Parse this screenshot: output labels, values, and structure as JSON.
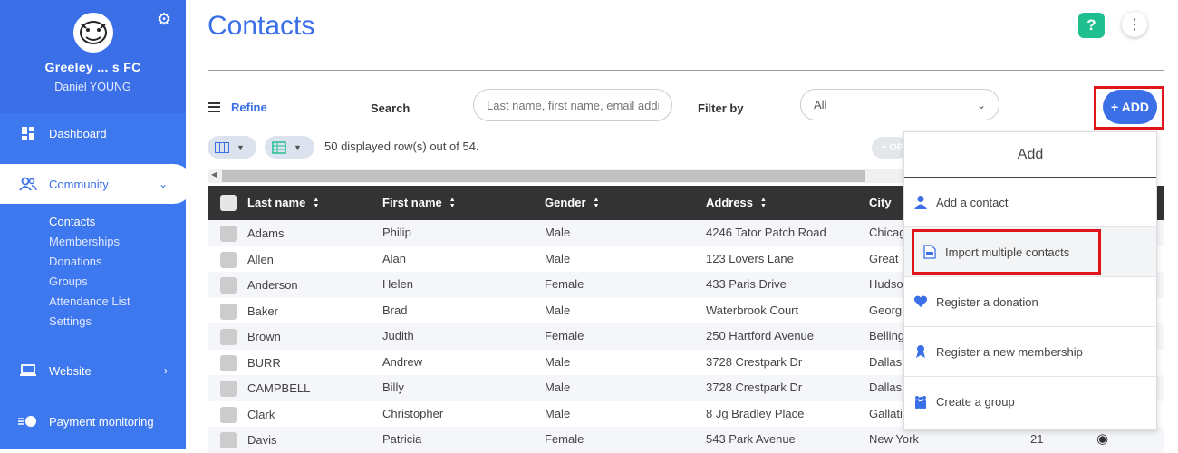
{
  "sidebar": {
    "club_name": "Greeley ... s FC",
    "user_name": "Daniel YOUNG",
    "items": [
      {
        "label": "Dashboard"
      },
      {
        "label": "Community"
      },
      {
        "label": "Website"
      },
      {
        "label": "Payment monitoring"
      }
    ],
    "community_sub": [
      "Contacts",
      "Memberships",
      "Donations",
      "Groups",
      "Attendance List",
      "Settings"
    ]
  },
  "header": {
    "title": "Contacts",
    "help_label": "?"
  },
  "toolbar": {
    "refine_label": "Refine",
    "search_label": "Search",
    "search_placeholder": "Last name, first name, email addr",
    "filter_label": "Filter by",
    "filter_value": "All",
    "add_label": "+ ADD",
    "rows_info": "50 displayed row(s) out of 54.",
    "ghost_label": "+ OP"
  },
  "table": {
    "columns": [
      "Last name",
      "First name",
      "Gender",
      "Address",
      "City"
    ],
    "rows": [
      {
        "last": "Adams",
        "first": "Philip",
        "gender": "Male",
        "address": "4246 Tator Patch Road",
        "city": "Chicag"
      },
      {
        "last": "Allen",
        "first": "Alan",
        "gender": "Male",
        "address": "123 Lovers Lane",
        "city": "Great F"
      },
      {
        "last": "Anderson",
        "first": "Helen",
        "gender": "Female",
        "address": "433 Paris Drive",
        "city": "Hudso"
      },
      {
        "last": "Baker",
        "first": "Brad",
        "gender": "Male",
        "address": "Waterbrook Court",
        "city": "Georgi"
      },
      {
        "last": "Brown",
        "first": "Judith",
        "gender": "Female",
        "address": "250 Hartford Avenue",
        "city": "Belling"
      },
      {
        "last": "BURR",
        "first": "Andrew",
        "gender": "Male",
        "address": "3728 Crestpark Dr",
        "city": "Dallas"
      },
      {
        "last": "CAMPBELL",
        "first": "Billy",
        "gender": "Male",
        "address": "3728 Crestpark Dr",
        "city": "Dallas"
      },
      {
        "last": "Clark",
        "first": "Christopher",
        "gender": "Male",
        "address": "8 Jg Bradley Place",
        "city": "Gallatin"
      },
      {
        "last": "Davis",
        "first": "Patricia",
        "gender": "Female",
        "address": "543 Park Avenue",
        "city": "New York",
        "extra": "21"
      }
    ]
  },
  "add_menu": {
    "title": "Add",
    "items": [
      {
        "label": "Add a contact",
        "icon": "person-icon"
      },
      {
        "label": "Import multiple contacts",
        "icon": "import-file-icon"
      },
      {
        "label": "Register a donation",
        "icon": "heart-icon"
      },
      {
        "label": "Register a new membership",
        "icon": "ribbon-icon"
      },
      {
        "label": "Create a group",
        "icon": "group-icon"
      }
    ]
  },
  "colors": {
    "primary": "#3a6fe8",
    "highlight": "#e0141b",
    "help": "#1fbf8f",
    "table_header": "#333333"
  }
}
